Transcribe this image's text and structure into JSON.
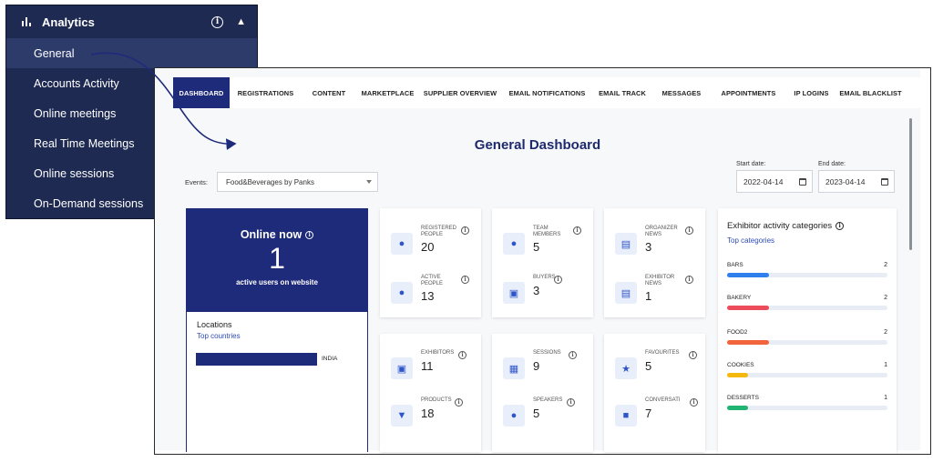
{
  "sidebar": {
    "header": {
      "title": "Analytics",
      "icon": "bar-chart-icon",
      "info_icon": "info-icon",
      "collapse_icon": "chevron-up-icon"
    },
    "items": [
      {
        "label": "General",
        "active": true
      },
      {
        "label": "Accounts Activity"
      },
      {
        "label": "Online meetings"
      },
      {
        "label": "Real Time Meetings"
      },
      {
        "label": "Online sessions"
      },
      {
        "label": "On-Demand sessions"
      }
    ]
  },
  "tabs": [
    {
      "label": "DASHBOARD",
      "active": true
    },
    {
      "label": "REGISTRATIONS"
    },
    {
      "label": "CONTENT"
    },
    {
      "label": "MARKETPLACE"
    },
    {
      "label": "SUPPLIER OVERVIEW"
    },
    {
      "label": "EMAIL NOTIFICATIONS"
    },
    {
      "label": "EMAIL TRACK"
    },
    {
      "label": "MESSAGES"
    },
    {
      "label": "APPOINTMENTS"
    },
    {
      "label": "IP LOGINS"
    },
    {
      "label": "EMAIL BLACKLIST"
    }
  ],
  "dashboard": {
    "title": "General Dashboard",
    "events": {
      "label": "Events:",
      "value": "Food&Beverages by Panks"
    },
    "start_date": {
      "label": "Start date:",
      "value": "2022-04-14"
    },
    "end_date": {
      "label": "End date:",
      "value": "2023-04-14"
    }
  },
  "online": {
    "title": "Online now",
    "count": "1",
    "subtitle": "active users on website"
  },
  "locations": {
    "title": "Locations",
    "subtitle": "Top countries",
    "rows": [
      {
        "label": "INDIA",
        "fraction": 1.0
      }
    ]
  },
  "stat_groups": [
    {
      "stats": [
        {
          "label": "REGISTERED PEOPLE",
          "value": "20",
          "icon": "person-icon",
          "glyph": "👤"
        },
        {
          "label": "ACTIVE PEOPLE",
          "value": "13",
          "icon": "person-icon",
          "glyph": "👤"
        }
      ]
    },
    {
      "stats": [
        {
          "label": "TEAM MEMBERS",
          "value": "5",
          "icon": "person-icon",
          "glyph": "👤"
        },
        {
          "label": "BUYERS",
          "value": "3",
          "icon": "briefcase-icon",
          "glyph": "💼"
        }
      ]
    },
    {
      "stats": [
        {
          "label": "ORGANIZER NEWS",
          "value": "3",
          "icon": "newspaper-icon",
          "glyph": "▤"
        },
        {
          "label": "EXHIBITOR NEWS",
          "value": "1",
          "icon": "newspaper-icon",
          "glyph": "▤"
        }
      ]
    },
    {
      "stats": [
        {
          "label": "EXHIBITORS",
          "value": "11",
          "icon": "briefcase-icon",
          "glyph": "💼"
        },
        {
          "label": "PRODUCTS",
          "value": "18",
          "icon": "cart-icon",
          "glyph": "🛒"
        }
      ]
    },
    {
      "stats": [
        {
          "label": "SESSIONS",
          "value": "9",
          "icon": "calendar-icon",
          "glyph": "▦"
        },
        {
          "label": "SPEAKERS",
          "value": "5",
          "icon": "microphone-icon",
          "glyph": "🎤"
        }
      ]
    },
    {
      "stats": [
        {
          "label": "FAVOURITES",
          "value": "5",
          "icon": "star-icon",
          "glyph": "★"
        },
        {
          "label": "CONVERSATI",
          "value": "7",
          "icon": "chat-icon",
          "glyph": "💬"
        }
      ]
    }
  ],
  "categories": {
    "title": "Exhibitor activity categories",
    "subtitle": "Top categories",
    "rows": [
      {
        "name": "BARS",
        "count": "2",
        "fraction": 0.26,
        "color": "#2f80ed"
      },
      {
        "name": "BAKERY",
        "count": "2",
        "fraction": 0.26,
        "color": "#eb4d5a"
      },
      {
        "name": "FOOD2",
        "count": "2",
        "fraction": 0.26,
        "color": "#f2643c"
      },
      {
        "name": "COOKIES",
        "count": "1",
        "fraction": 0.13,
        "color": "#f5b80d"
      },
      {
        "name": "DESSERTS",
        "count": "1",
        "fraction": 0.13,
        "color": "#21b573"
      }
    ]
  },
  "colors": {
    "sidebar_bg": "#1e2a52",
    "accent": "#1e2a7a",
    "link": "#2e4bb5"
  }
}
